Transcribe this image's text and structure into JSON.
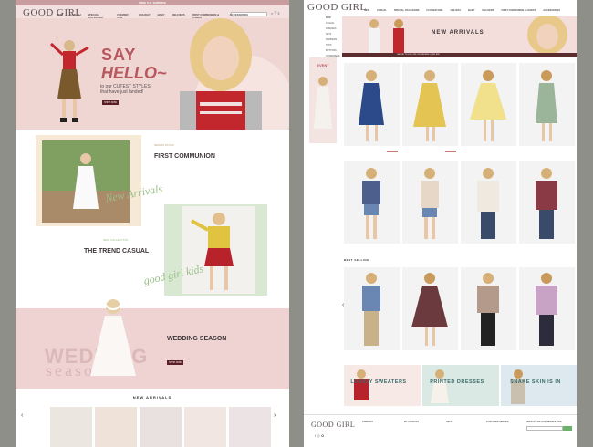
{
  "left_page": {
    "topbar": "FREE U.S. SHIPPING",
    "logo": "GOOD GIRL",
    "logo_sub": "SHOWROOM",
    "nav": [
      "NEW",
      "CASUAL",
      "SPECIAL OCCASIONS",
      "FLOWER GIRL",
      "HOLIDAY",
      "BABY",
      "DELIVERS",
      "FIRST COMMUNION & CHRIST",
      "ACCESSORIES"
    ],
    "hero": {
      "say": "SAY",
      "hello": "HELLO~",
      "line1": "to our CUTEST STYLES",
      "line2": "that have just landed!",
      "button": "SHOP NOW"
    },
    "first_communion": {
      "kicker": "NEW IN STOCK",
      "title": "FIRST COMMUNION",
      "script": "New Arrivals"
    },
    "trend_casual": {
      "kicker": "NEW COLLECTION",
      "title": "THE TREND CASUAL",
      "script": "good girl kids"
    },
    "wedding": {
      "title": "WEDDING SEASON",
      "bg_word1": "WEDDING",
      "bg_word2": "season",
      "button": "SHOP NOW"
    },
    "new_arrivals": "NEW ARRIVALS"
  },
  "right_page": {
    "logo": "GOOD GIRL",
    "nav": [
      "NEW",
      "CASUAL",
      "SPECIAL OCCASIONS",
      "FLOWER GIRL",
      "HOLIDAY",
      "BABY",
      "DELIVERS",
      "FIRST COMMUNION & CHRIST",
      "ACCESSORIES"
    ],
    "side_menu": [
      "NEW",
      "CASUAL",
      "DRESSES",
      "SETS",
      "ROMPERS",
      "TOPS",
      "BOTTOMS",
      "OUTERWEAR"
    ],
    "banner_title": "NEW ARRIVALS",
    "promo": "GET UP TO 10% OFF ON ORDERS OVER $99",
    "event": "EVENT",
    "best_selling": "BEST SELLING",
    "banners": [
      {
        "text": "LOVELY SWEATERS"
      },
      {
        "text": "PRINTED DRESSES"
      },
      {
        "text": "SNAKE SKIN IS IN"
      }
    ],
    "footer_logo": "GOOD GIRL",
    "footer_cols": [
      "COMPANY",
      "MY ACCOUNT",
      "HELP",
      "CUSTOMER SERVICE",
      "SIGN UP FOR OUR NEWSLETTER"
    ]
  },
  "colors": {
    "pink": "#efd6d3",
    "maroon": "#5b2c2e",
    "green": "#d9e8d3",
    "cream": "#f6ead6"
  }
}
